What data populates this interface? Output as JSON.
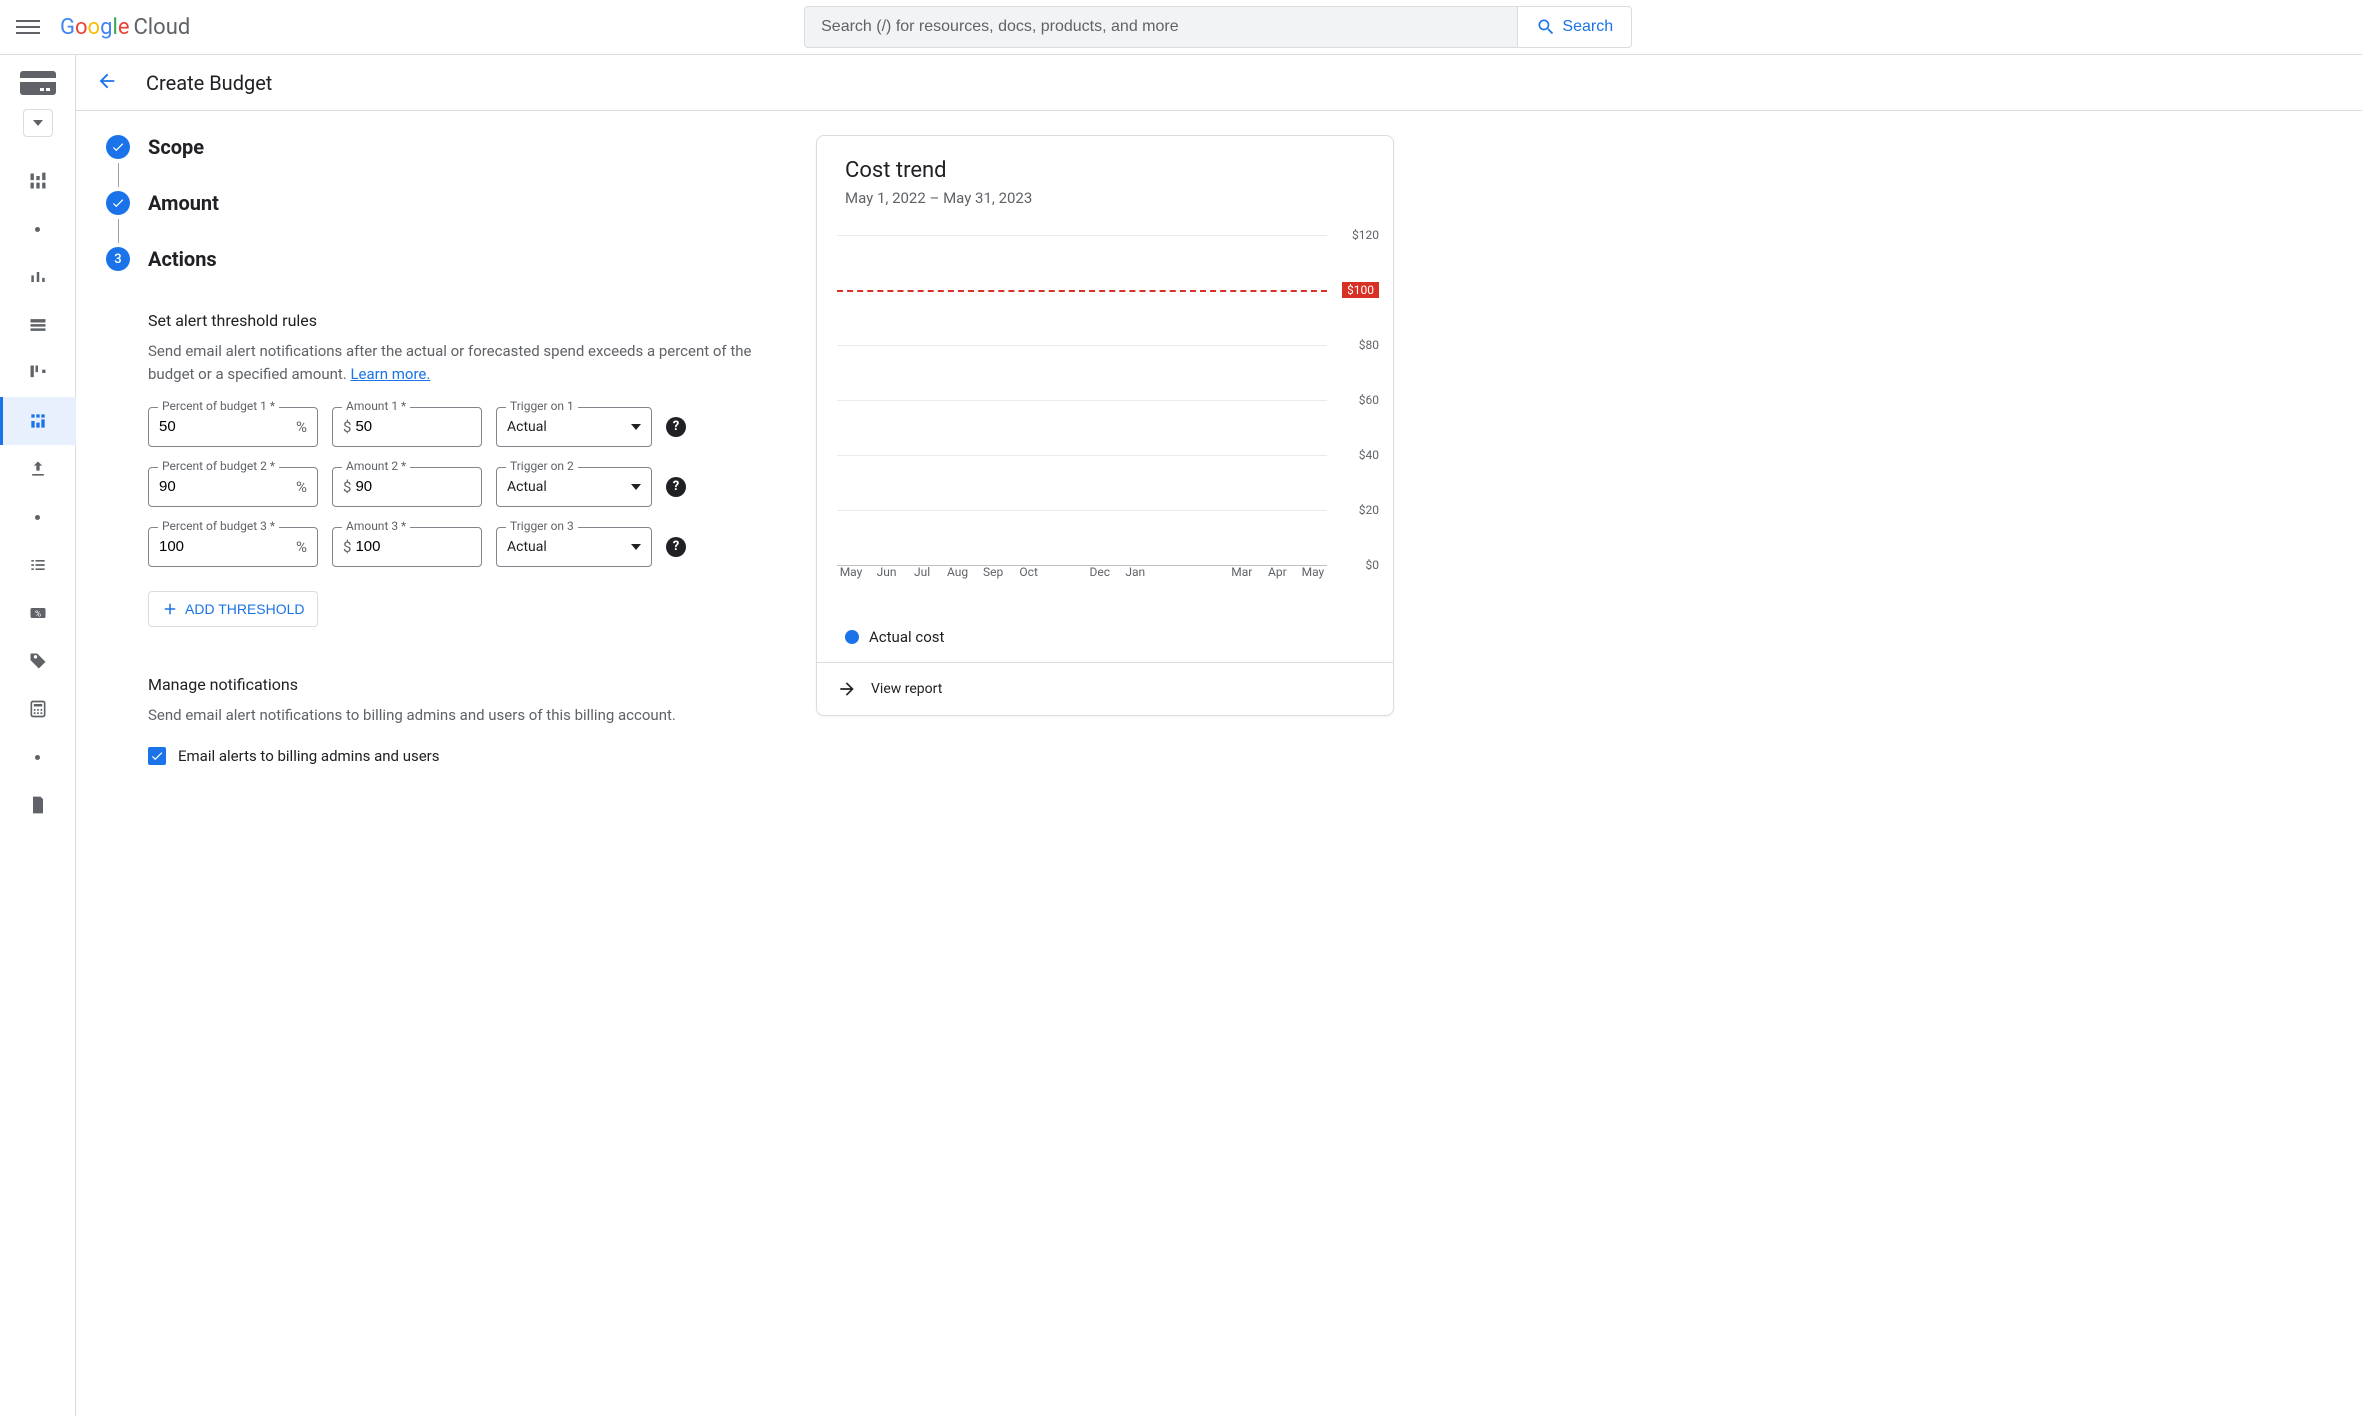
{
  "header": {
    "logo_google": "Google",
    "logo_cloud": "Cloud",
    "search_placeholder": "Search (/) for resources, docs, products, and more",
    "search_button": "Search"
  },
  "page": {
    "title": "Create Budget"
  },
  "stepper": {
    "steps": [
      {
        "label": "Scope",
        "state": "done"
      },
      {
        "label": "Amount",
        "state": "done"
      },
      {
        "label": "Actions",
        "state": "active",
        "number": "3"
      }
    ]
  },
  "thresholds": {
    "title": "Set alert threshold rules",
    "description": "Send email alert notifications after the actual or forecasted spend exceeds a percent of the budget or a specified amount. ",
    "learn_more": "Learn more.",
    "rows": [
      {
        "pct_label": "Percent of budget 1 *",
        "pct_value": "50",
        "amt_label": "Amount 1 *",
        "amt_value": "50",
        "trig_label": "Trigger on 1",
        "trig_value": "Actual"
      },
      {
        "pct_label": "Percent of budget 2 *",
        "pct_value": "90",
        "amt_label": "Amount 2 *",
        "amt_value": "90",
        "trig_label": "Trigger on 2",
        "trig_value": "Actual"
      },
      {
        "pct_label": "Percent of budget 3 *",
        "pct_value": "100",
        "amt_label": "Amount 3 *",
        "amt_value": "100",
        "trig_label": "Trigger on 3",
        "trig_value": "Actual"
      }
    ],
    "add_button": "ADD THRESHOLD"
  },
  "notifications": {
    "title": "Manage notifications",
    "description": "Send email alert notifications to billing admins and users of this billing account.",
    "checkbox_label": "Email alerts to billing admins and users"
  },
  "cost_trend": {
    "title": "Cost trend",
    "date_range": "May 1, 2022 – May 31, 2023",
    "budget_label": "$100",
    "legend": "Actual cost",
    "view_report": "View report"
  },
  "chart_data": {
    "type": "bar",
    "title": "Cost trend",
    "xlabel": "",
    "ylabel": "",
    "ylim": [
      0,
      120
    ],
    "y_ticks": [
      "$0",
      "$20",
      "$40",
      "$60",
      "$80",
      "$120"
    ],
    "budget_line": 100,
    "categories": [
      "May",
      "Jun",
      "Jul",
      "Aug",
      "Sep",
      "Oct",
      "",
      "Dec",
      "Jan",
      "",
      "",
      "Mar",
      "Apr",
      "May"
    ],
    "series": [
      {
        "name": "Actual cost",
        "values": [
          0,
          0,
          0,
          0,
          0,
          0,
          0,
          0,
          0,
          0,
          0,
          0,
          0,
          0
        ]
      }
    ]
  }
}
